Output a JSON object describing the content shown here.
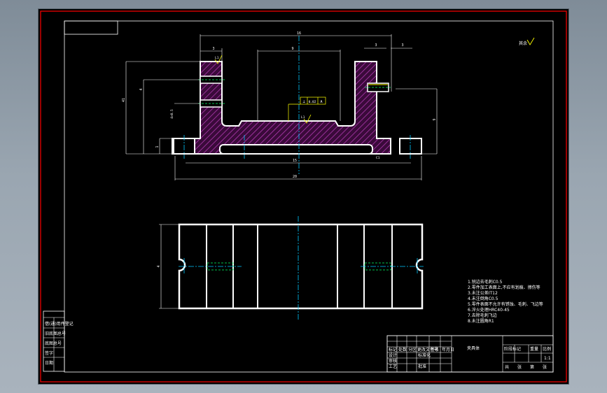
{
  "colors": {
    "background": "#000000",
    "border": "#ff0000",
    "outline": "#ffffff",
    "dimension": "#ffffff",
    "centerline": "#00c8ff",
    "hidden": "#00ff66",
    "hatch": "#c040c0",
    "section_fill": "#3a0a3a",
    "annotation": "#ffff00"
  },
  "front_view": {
    "dimensions": {
      "overall_top": "16",
      "left_ear": "3",
      "center_gap": "9",
      "right_ear": "3",
      "right_ear_offset": "3",
      "left_height": "41",
      "left_mid": "4",
      "left_bottom": "1",
      "left_chamfer": "4×0.5",
      "bottom_slot": "15",
      "bottom_overall": "20",
      "right_height": "9",
      "hole_label_left": "L1",
      "hole_label_right": "L1",
      "corner_label": "C1"
    },
    "gdt_frame": [
      "⊥",
      "0.02",
      "A"
    ]
  },
  "top_view": {
    "dim_left": "4"
  },
  "roughness_mark": "其余",
  "technical_notes": [
    "1.锐边去毛刺C0.5",
    "2.零件加工表面上,不应有划痕、擦伤等",
    "3.未注公差IT12",
    "4.未注倒角C0.5",
    "5.零件表面不允许有锈蚀、毛刺、飞边等",
    "6.淬火处理HRC40-45",
    "7.去除毛刺飞边",
    "8.未注圆角R1"
  ],
  "title_block": {
    "part_name": "夹具体",
    "scale": "1:1",
    "row_labels": [
      "标记",
      "处数",
      "分区",
      "更改文件号",
      "签名",
      "年月日"
    ],
    "role_labels": [
      "设计",
      "审核",
      "工艺",
      "批准"
    ],
    "std_label": "标准化",
    "right_headers": [
      "阶段标记",
      "重量",
      "比例"
    ],
    "sheet_info": [
      "共",
      "张",
      "第",
      "张"
    ]
  },
  "side_table": {
    "rows": [
      "借(通)用件登记",
      "旧底图总号",
      "底图总号",
      "签字",
      "日期"
    ]
  }
}
